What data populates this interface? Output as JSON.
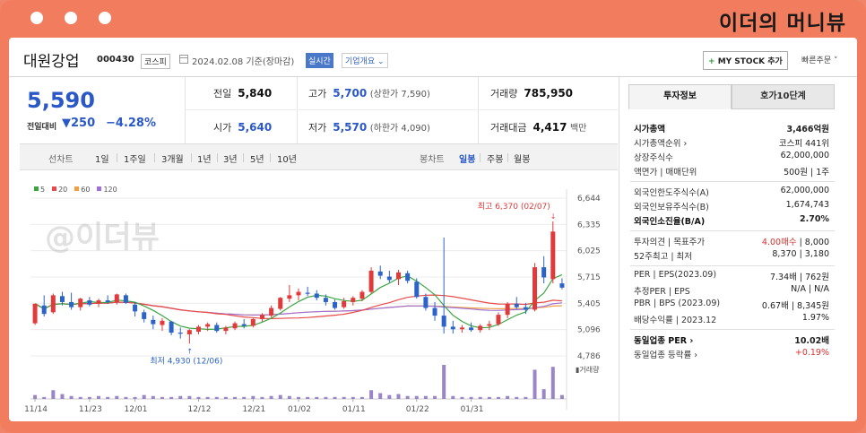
{
  "brand": "이더의 머니뷰",
  "watermark": "@이더뷰",
  "header": {
    "name": "대원강업",
    "code": "000430",
    "market": "코스피",
    "date": "2024.02.08 기준(장마감)",
    "realtime": "실시간",
    "overview": "기업개요",
    "mystock": "MY STOCK 추가",
    "mystock_plus": "+",
    "quick_order": "빠른주문"
  },
  "price": {
    "current": "5,590",
    "change_label": "전일대비",
    "change_amt": "▼250",
    "change_pct": "−4.28%"
  },
  "stats": {
    "prev_label": "전일",
    "prev": "5,840",
    "high_label": "고가",
    "high": "5,700",
    "high_sub": "(상한가 7,590)",
    "volume_label": "거래량",
    "volume": "785,950",
    "open_label": "시가",
    "open": "5,640",
    "low_label": "저가",
    "low": "5,570",
    "low_sub": "(하한가 4,090)",
    "amount_label": "거래대금",
    "amount": "4,417",
    "amount_unit": "백만"
  },
  "periods": {
    "items": [
      "선차트",
      "1일",
      "1주일",
      "3개월",
      "1년",
      "3년",
      "5년",
      "10년"
    ],
    "chart_types": [
      "봉차트",
      "일봉",
      "주봉",
      "월봉"
    ]
  },
  "chart_data": {
    "type": "candlestick",
    "legend": [
      "5",
      "20",
      "60",
      "120"
    ],
    "legend_colors": [
      "#3aa642",
      "#e84a4a",
      "#f0a040",
      "#a070d8"
    ],
    "ylim": [
      4786,
      6644
    ],
    "yticks": [
      "6,644",
      "6,335",
      "6,025",
      "5,715",
      "5,405",
      "5,096",
      "4,786"
    ],
    "xticks": [
      "11/14",
      "11/23",
      "12/01",
      "12/12",
      "12/21",
      "01/02",
      "01/11",
      "01/22",
      "01/31"
    ],
    "max_label": "최고 6,370 (02/07)",
    "min_label": "최저 4,930 (12/06)",
    "volume_label": "거래량",
    "candles": [
      [
        5170,
        5400,
        5150,
        5400
      ],
      [
        5380,
        5500,
        5250,
        5280
      ],
      [
        5300,
        5520,
        5280,
        5500
      ],
      [
        5490,
        5540,
        5380,
        5420
      ],
      [
        5420,
        5530,
        5330,
        5360
      ],
      [
        5360,
        5470,
        5320,
        5460
      ],
      [
        5440,
        5480,
        5370,
        5390
      ],
      [
        5400,
        5460,
        5360,
        5440
      ],
      [
        5440,
        5500,
        5400,
        5420
      ],
      [
        5420,
        5520,
        5390,
        5510
      ],
      [
        5500,
        5520,
        5400,
        5410
      ],
      [
        5390,
        5420,
        5250,
        5310
      ],
      [
        5300,
        5330,
        5180,
        5220
      ],
      [
        5210,
        5260,
        5100,
        5160
      ],
      [
        5150,
        5230,
        5080,
        5200
      ],
      [
        5190,
        5200,
        5030,
        5060
      ],
      [
        5060,
        5120,
        4990,
        5050
      ],
      [
        5040,
        5100,
        4930,
        5090
      ],
      [
        5070,
        5150,
        5040,
        5130
      ],
      [
        5130,
        5180,
        5080,
        5160
      ],
      [
        5150,
        5180,
        5060,
        5080
      ],
      [
        5080,
        5140,
        5040,
        5120
      ],
      [
        5110,
        5190,
        5090,
        5170
      ],
      [
        5160,
        5220,
        5110,
        5140
      ],
      [
        5140,
        5230,
        5120,
        5220
      ],
      [
        5220,
        5290,
        5190,
        5270
      ],
      [
        5260,
        5380,
        5240,
        5350
      ],
      [
        5340,
        5480,
        5320,
        5470
      ],
      [
        5460,
        5620,
        5420,
        5500
      ],
      [
        5500,
        5580,
        5440,
        5540
      ],
      [
        5530,
        5600,
        5490,
        5520
      ],
      [
        5520,
        5560,
        5440,
        5470
      ],
      [
        5470,
        5510,
        5380,
        5420
      ],
      [
        5420,
        5450,
        5330,
        5350
      ],
      [
        5360,
        5470,
        5340,
        5430
      ],
      [
        5420,
        5490,
        5380,
        5470
      ],
      [
        5460,
        5560,
        5430,
        5540
      ],
      [
        5540,
        5830,
        5520,
        5790
      ],
      [
        5780,
        5850,
        5690,
        5730
      ],
      [
        5720,
        5790,
        5650,
        5680
      ],
      [
        5690,
        5800,
        5620,
        5770
      ],
      [
        5760,
        5790,
        5640,
        5670
      ],
      [
        5660,
        5700,
        5460,
        5480
      ],
      [
        5480,
        5520,
        5320,
        5350
      ],
      [
        5350,
        5420,
        5200,
        5260
      ],
      [
        5260,
        6180,
        5050,
        5130
      ],
      [
        5130,
        5200,
        5050,
        5100
      ],
      [
        5100,
        5150,
        5060,
        5120
      ],
      [
        5120,
        5180,
        5070,
        5090
      ],
      [
        5090,
        5160,
        5060,
        5140
      ],
      [
        5140,
        5200,
        5090,
        5160
      ],
      [
        5160,
        5300,
        5140,
        5270
      ],
      [
        5270,
        5420,
        5230,
        5400
      ],
      [
        5400,
        5480,
        5340,
        5360
      ],
      [
        5360,
        5410,
        5280,
        5330
      ],
      [
        5330,
        5880,
        5310,
        5830
      ],
      [
        5830,
        5960,
        5640,
        5710
      ],
      [
        5690,
        6370,
        5640,
        6250
      ],
      [
        5640,
        5700,
        5570,
        5590
      ]
    ],
    "volumes": [
      0.4,
      0.2,
      0.9,
      0.5,
      0.3,
      0.2,
      0.2,
      0.3,
      0.2,
      0.3,
      0.2,
      0.2,
      0.4,
      0.3,
      0.2,
      0.2,
      0.3,
      0.3,
      0.2,
      0.2,
      0.2,
      0.2,
      0.2,
      0.2,
      0.3,
      0.2,
      0.3,
      0.4,
      0.3,
      0.2,
      0.2,
      0.2,
      0.2,
      0.2,
      0.2,
      0.2,
      0.2,
      0.9,
      0.6,
      0.4,
      0.5,
      0.3,
      0.3,
      0.3,
      0.3,
      3.5,
      0.3,
      0.2,
      0.2,
      0.2,
      0.2,
      0.2,
      0.3,
      0.2,
      0.2,
      3.0,
      1.0,
      3.3,
      0.4
    ]
  },
  "rpanel": {
    "tab_info": "투자정보",
    "tab_order": "호가10단계",
    "rows1": [
      {
        "k": "시가총액",
        "v": "3,466억원",
        "bold": true
      },
      {
        "k": "시가총액순위 ›",
        "v": "코스피 441위"
      },
      {
        "k": "상장주식수",
        "v": "62,000,000"
      },
      {
        "k": "액면가 | 매매단위",
        "v": "500원 | 1주"
      }
    ],
    "rows2": [
      {
        "k": "외국인한도주식수(A)",
        "v": "62,000,000"
      },
      {
        "k": "외국인보유주식수(B)",
        "v": "1,674,743"
      },
      {
        "k": "외국인소진율(B/A)",
        "v": "2.70%",
        "bold": true
      }
    ],
    "rows3": [
      {
        "k": "투자의견 | 목표주가",
        "v_red": "4.00매수",
        "v": " | 8,000"
      },
      {
        "k": "52주최고 | 최저",
        "v": "8,370 | 3,180"
      }
    ],
    "rows4": [
      {
        "k": "PER | EPS(2023.09)",
        "v": "7.34배 | 762원"
      },
      {
        "k": "추정PER | EPS",
        "v": "N/A | N/A"
      },
      {
        "k": "PBR | BPS (2023.09)",
        "v": "0.67배 | 8,345원"
      },
      {
        "k": "배당수익률 | 2023.12",
        "v": "1.97%"
      }
    ],
    "rows5": [
      {
        "k": "동일업종 PER ›",
        "v": "10.02배",
        "bold": true
      },
      {
        "k": "동일업종 등락률 ›",
        "v": "+0.19%",
        "red": true
      }
    ]
  }
}
